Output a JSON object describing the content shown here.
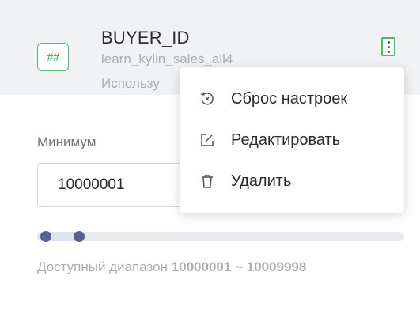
{
  "card": {
    "type_badge": "##",
    "field_name": "BUYER_ID",
    "source_table": "learn_kylin_sales_all4",
    "usage_text": "Использу"
  },
  "filter": {
    "min_label": "Минимум",
    "min_value": "10000001",
    "range_prefix": "Доступный диапазон",
    "range_value": "10000001 ~ 10009998"
  },
  "menu": {
    "items": [
      {
        "label": "Сброс настроек",
        "icon": "reset-icon"
      },
      {
        "label": "Редактировать",
        "icon": "edit-icon"
      },
      {
        "label": "Удалить",
        "icon": "trash-icon"
      }
    ]
  },
  "colors": {
    "accent_green": "#4cb96d",
    "slider_handle": "#57608f",
    "header_bg": "#f1f2f3"
  }
}
